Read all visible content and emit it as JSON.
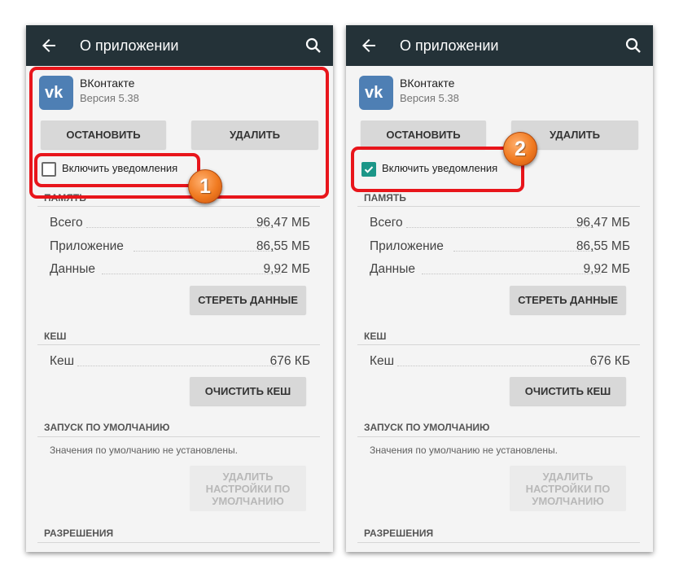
{
  "panels": [
    {
      "toolbar": {
        "title": "О приложении",
        "back_icon": "arrow-left-icon",
        "search_icon": "search-icon"
      },
      "app": {
        "name": "ВКонтакте",
        "version": "Версия 5.38",
        "icon": "vk-logo-icon"
      },
      "buttons": {
        "stop": "ОСТАНОВИТЬ",
        "delete": "УДАЛИТЬ"
      },
      "notifications": {
        "label": "Включить уведомления",
        "checked": false
      },
      "storage": {
        "header": "ПАМЯТЬ",
        "rows": [
          {
            "label": "Всего",
            "value": "96,47 МБ"
          },
          {
            "label": "Приложение",
            "value": "86,55 МБ"
          },
          {
            "label": "Данные",
            "value": "9,92 МБ"
          }
        ],
        "clear_data": "СТЕРЕТЬ ДАННЫЕ"
      },
      "cache": {
        "header": "КЕШ",
        "row_label": "Кеш",
        "row_value": "676 КБ",
        "clear_cache": "ОЧИСТИТЬ КЕШ"
      },
      "launch": {
        "header": "ЗАПУСК ПО УМОЛЧАНИЮ",
        "text": "Значения по умолчанию не установлены.",
        "reset_lines": [
          "УДАЛИТЬ",
          "НАСТРОЙКИ ПО",
          "УМОЛЧАНИЮ"
        ]
      },
      "permissions": {
        "header": "РАЗРЕШЕНИЯ"
      },
      "step_badge": "1"
    },
    {
      "toolbar": {
        "title": "О приложении",
        "back_icon": "arrow-left-icon",
        "search_icon": "search-icon"
      },
      "app": {
        "name": "ВКонтакте",
        "version": "Версия 5.38",
        "icon": "vk-logo-icon"
      },
      "buttons": {
        "stop": "ОСТАНОВИТЬ",
        "delete": "УДАЛИТЬ"
      },
      "notifications": {
        "label": "Включить уведомления",
        "checked": true
      },
      "storage": {
        "header": "ПАМЯТЬ",
        "rows": [
          {
            "label": "Всего",
            "value": "96,47 МБ"
          },
          {
            "label": "Приложение",
            "value": "86,55 МБ"
          },
          {
            "label": "Данные",
            "value": "9,92 МБ"
          }
        ],
        "clear_data": "СТЕРЕТЬ ДАННЫЕ"
      },
      "cache": {
        "header": "КЕШ",
        "row_label": "Кеш",
        "row_value": "676 КБ",
        "clear_cache": "ОЧИСТИТЬ КЕШ"
      },
      "launch": {
        "header": "ЗАПУСК ПО УМОЛЧАНИЮ",
        "text": "Значения по умолчанию не установлены.",
        "reset_lines": [
          "УДАЛИТЬ",
          "НАСТРОЙКИ ПО",
          "УМОЛЧАНИЮ"
        ]
      },
      "permissions": {
        "header": "РАЗРЕШЕНИЯ"
      },
      "step_badge": "2"
    }
  ],
  "colors": {
    "appbar": "#243238",
    "highlight": "#e8151b",
    "checkbox_checked": "#1c9688",
    "vk_blue": "#4e7fb4",
    "badge": "#f07a20"
  }
}
